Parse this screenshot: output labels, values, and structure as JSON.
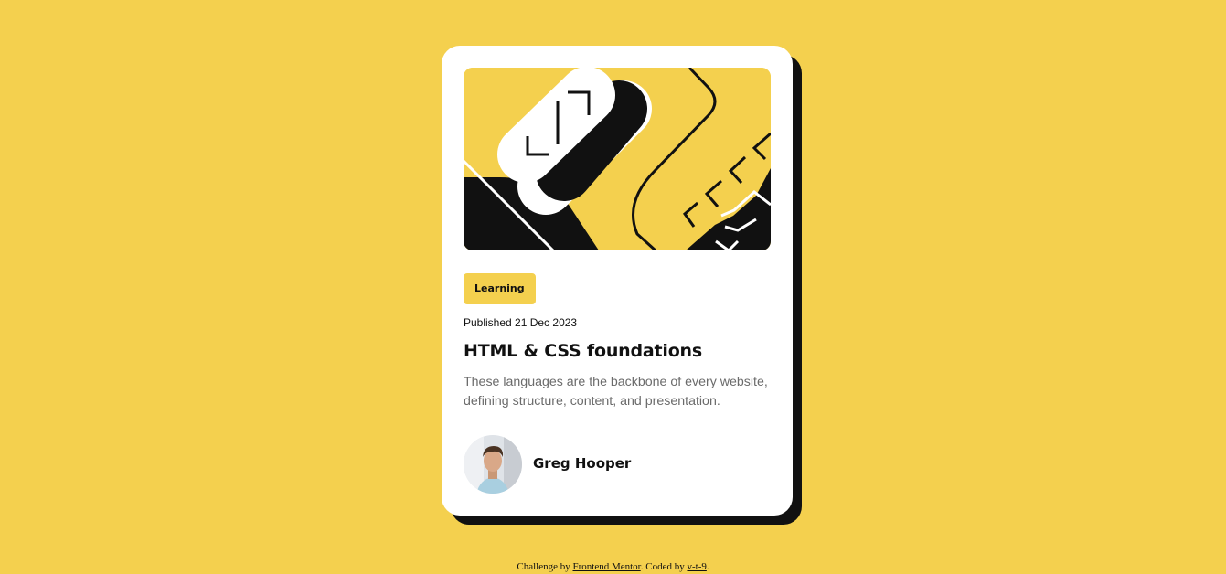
{
  "card": {
    "tag": "Learning",
    "published": "Published 21 Dec 2023",
    "title": "HTML & CSS foundations",
    "description": "These languages are the backbone of every website, defining structure, content, and presentation.",
    "author": "Greg Hooper"
  },
  "footer": {
    "prefix": "Challenge by ",
    "link1": "Frontend Mentor",
    "middle": ". Coded by ",
    "link2": "v-t-9",
    "suffix": "."
  },
  "colors": {
    "background": "#f4d04e",
    "card": "#ffffff",
    "shadow": "#111111",
    "text": "#111111",
    "muted": "#6b6b6b"
  },
  "icons": {
    "hero": "abstract-code-illustration",
    "avatar": "author-photo"
  }
}
